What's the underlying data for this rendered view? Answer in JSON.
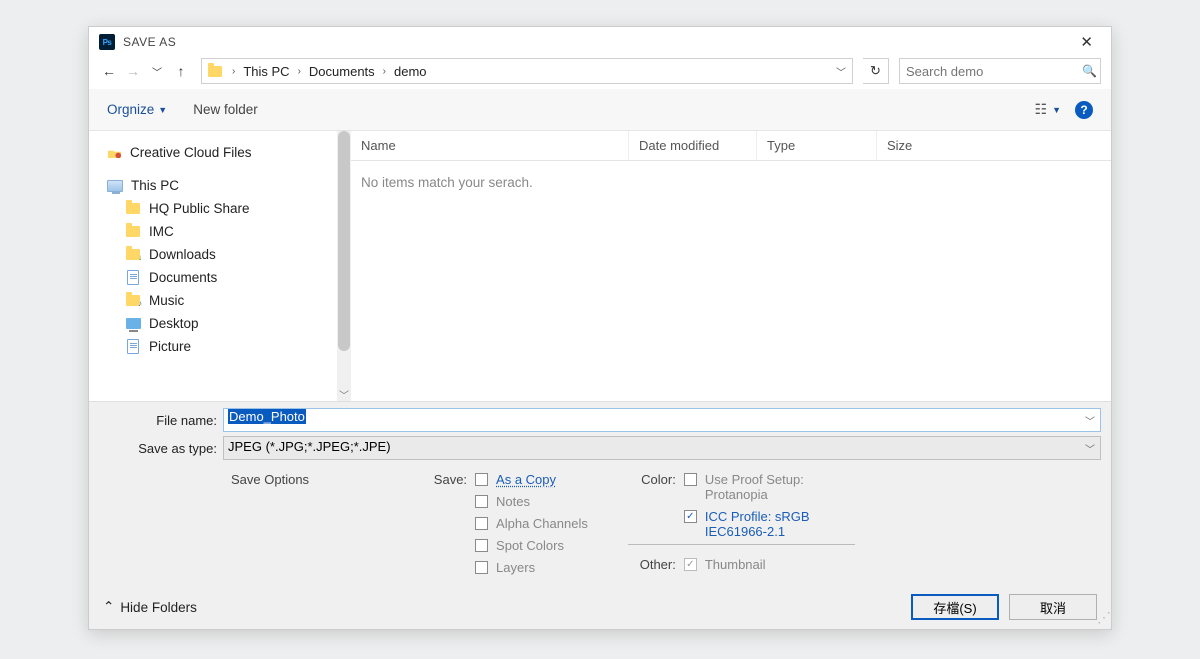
{
  "window": {
    "title": "SAVE AS"
  },
  "breadcrumb": {
    "items": [
      "This PC",
      "Documents",
      "demo"
    ]
  },
  "search": {
    "placeholder": "Search demo"
  },
  "toolbar": {
    "organize": "Orgnize",
    "newfolder": "New folder"
  },
  "tree": {
    "items": [
      {
        "label": "Creative Cloud Files",
        "icon": "cloud"
      },
      {
        "label": "This PC",
        "icon": "pc"
      },
      {
        "label": "HQ Public Share",
        "icon": "y-folder",
        "indent": 1
      },
      {
        "label": "IMC",
        "icon": "y-folder",
        "indent": 1
      },
      {
        "label": "Downloads",
        "icon": "dl-folder",
        "indent": 1
      },
      {
        "label": "Documents",
        "icon": "file",
        "indent": 1
      },
      {
        "label": "Music",
        "icon": "music-folder",
        "indent": 1
      },
      {
        "label": "Desktop",
        "icon": "desk",
        "indent": 1
      },
      {
        "label": "Picture",
        "icon": "file",
        "indent": 1
      }
    ]
  },
  "columns": {
    "name": "Name",
    "date": "Date modified",
    "type": "Type",
    "size": "Size"
  },
  "filelist": {
    "empty": "No items match your serach."
  },
  "form": {
    "filename_label": "File name:",
    "filename_value": "Demo_Photo",
    "type_label": "Save as type:",
    "type_value": "JPEG (*.JPG;*.JPEG;*.JPE)"
  },
  "options": {
    "header": "Save Options",
    "save_label": "Save:",
    "as_a_copy": "As a Copy",
    "notes": "Notes",
    "alpha": "Alpha Channels",
    "spot": "Spot Colors",
    "layers": "Layers",
    "color_label": "Color:",
    "proof": "Use Proof Setup: Protanopia",
    "icc": "ICC Profile:  sRGB IEC61966-2.1",
    "other_label": "Other:",
    "thumbnail": "Thumbnail"
  },
  "footer": {
    "hide": "Hide Folders",
    "save": "存檔(S)",
    "cancel": "取消"
  }
}
